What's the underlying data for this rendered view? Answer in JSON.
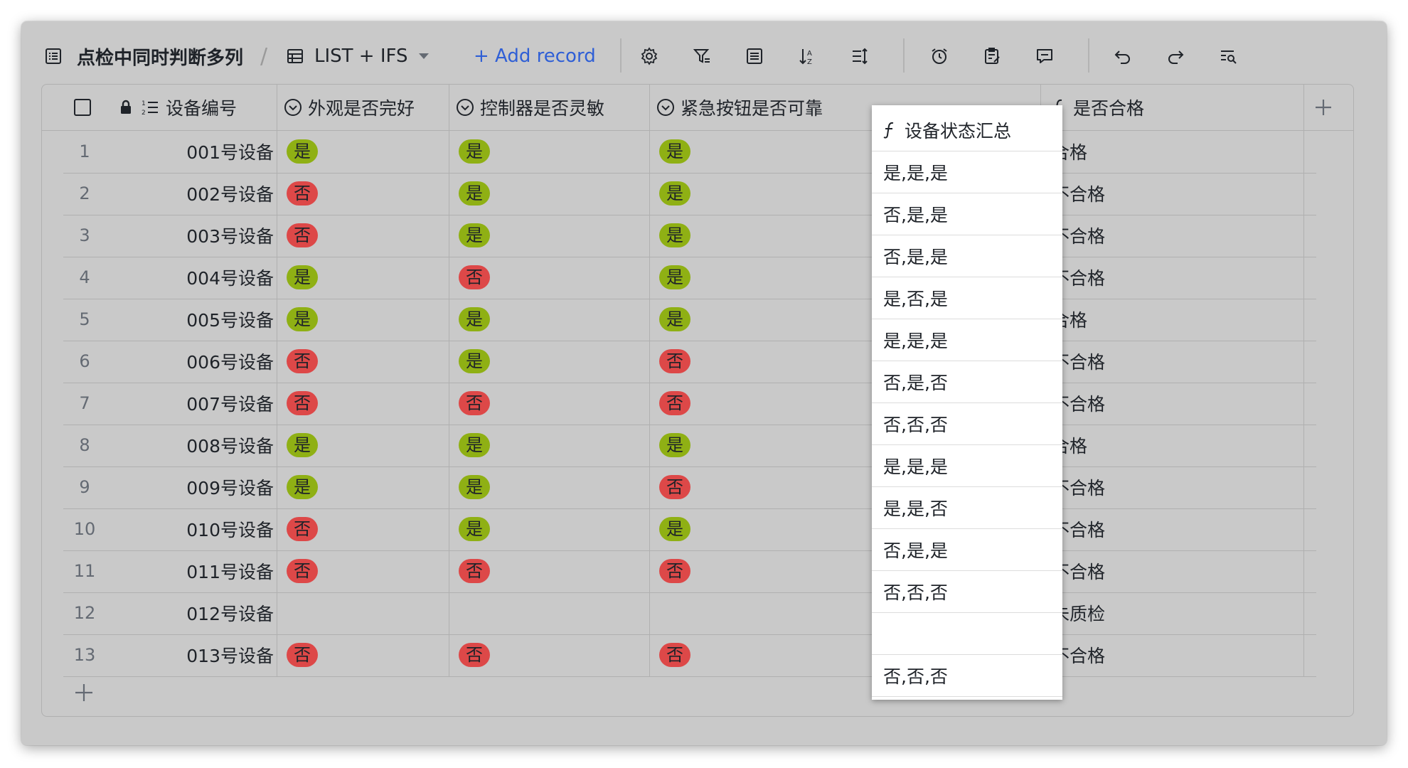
{
  "toolbar": {
    "doc_title": "点检中同时判断多列",
    "separator": "/",
    "view_name": "LIST + IFS",
    "add_record_label": "+ Add record"
  },
  "columns": {
    "device_id": "设备编号",
    "appearance": "外观是否完好",
    "controller": "控制器是否灵敏",
    "emergency": "紧急按钮是否可靠",
    "summary": "设备状态汇总",
    "qualified": "是否合格"
  },
  "colors": {
    "yes": "#8fb014",
    "no": "#dd4848",
    "accent": "#2f5fd6"
  },
  "rows": [
    {
      "num": "1",
      "id": "001号设备",
      "a": "是",
      "c": "是",
      "e": "是",
      "summary": "是,是,是",
      "result": "合格"
    },
    {
      "num": "2",
      "id": "002号设备",
      "a": "否",
      "c": "是",
      "e": "是",
      "summary": "否,是,是",
      "result": "不合格"
    },
    {
      "num": "3",
      "id": "003号设备",
      "a": "否",
      "c": "是",
      "e": "是",
      "summary": "否,是,是",
      "result": "不合格"
    },
    {
      "num": "4",
      "id": "004号设备",
      "a": "是",
      "c": "否",
      "e": "是",
      "summary": "是,否,是",
      "result": "不合格"
    },
    {
      "num": "5",
      "id": "005号设备",
      "a": "是",
      "c": "是",
      "e": "是",
      "summary": "是,是,是",
      "result": "合格"
    },
    {
      "num": "6",
      "id": "006号设备",
      "a": "否",
      "c": "是",
      "e": "否",
      "summary": "否,是,否",
      "result": "不合格"
    },
    {
      "num": "7",
      "id": "007号设备",
      "a": "否",
      "c": "否",
      "e": "否",
      "summary": "否,否,否",
      "result": "不合格"
    },
    {
      "num": "8",
      "id": "008号设备",
      "a": "是",
      "c": "是",
      "e": "是",
      "summary": "是,是,是",
      "result": "合格"
    },
    {
      "num": "9",
      "id": "009号设备",
      "a": "是",
      "c": "是",
      "e": "否",
      "summary": "是,是,否",
      "result": "不合格"
    },
    {
      "num": "10",
      "id": "010号设备",
      "a": "否",
      "c": "是",
      "e": "是",
      "summary": "否,是,是",
      "result": "不合格"
    },
    {
      "num": "11",
      "id": "011号设备",
      "a": "否",
      "c": "否",
      "e": "否",
      "summary": "否,否,否",
      "result": "不合格"
    },
    {
      "num": "12",
      "id": "012号设备",
      "a": "",
      "c": "",
      "e": "",
      "summary": "",
      "result": "未质检"
    },
    {
      "num": "13",
      "id": "013号设备",
      "a": "否",
      "c": "否",
      "e": "否",
      "summary": "否,否,否",
      "result": "不合格"
    }
  ]
}
